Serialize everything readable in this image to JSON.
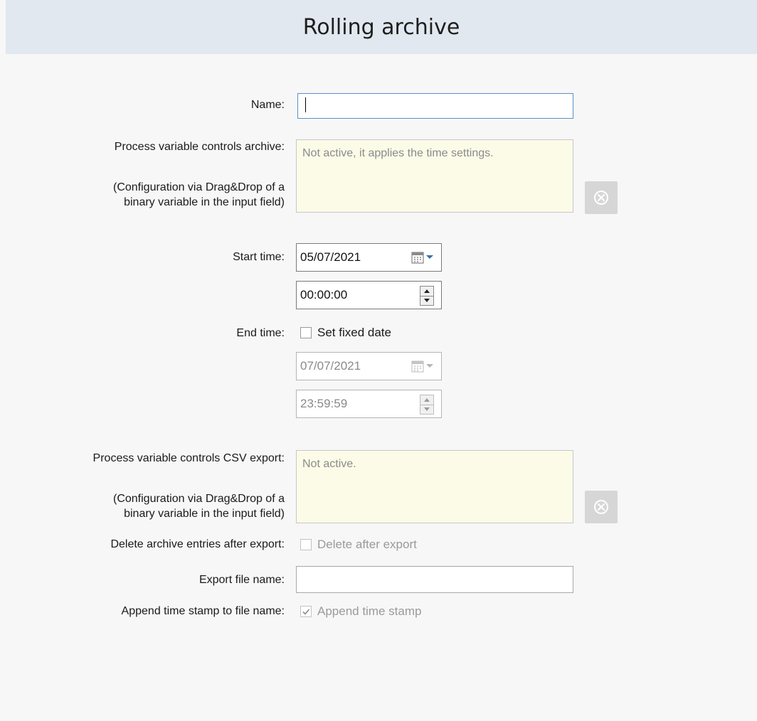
{
  "header": {
    "title": "Rolling archive"
  },
  "labels": {
    "name": "Name:",
    "pv_archive": "Process variable controls archive:",
    "pv_archive_hint_1": "(Configuration via Drag&Drop of a",
    "pv_archive_hint_2": "binary variable in the input field)",
    "start_time": "Start time:",
    "end_time": "End time:",
    "pv_csv": "Process variable controls CSV export:",
    "pv_csv_hint_1": "(Configuration via Drag&Drop of a",
    "pv_csv_hint_2": "binary variable in the input field)",
    "delete_entries": "Delete archive entries after export:",
    "export_file_name": "Export file name:",
    "append_timestamp": "Append time stamp to file name:"
  },
  "fields": {
    "name": {
      "value": ""
    },
    "pv_archive": {
      "text": "Not active, it applies the time settings."
    },
    "start_date": {
      "value": "05/07/2021"
    },
    "start_time": {
      "value": "00:00:00"
    },
    "end_fixed_date": {
      "label": "Set fixed date",
      "checked": false
    },
    "end_date": {
      "value": "07/07/2021",
      "enabled": false
    },
    "end_time": {
      "value": "23:59:59",
      "enabled": false
    },
    "pv_csv": {
      "text": "Not active."
    },
    "delete_after_export": {
      "label": "Delete after export",
      "checked": false,
      "enabled": false
    },
    "export_file_name": {
      "value": ""
    },
    "append_timestamp": {
      "label": "Append time stamp",
      "checked": true,
      "enabled": false
    }
  },
  "icons": {
    "clear": "clear-icon",
    "calendar": "calendar-icon",
    "spin": "spin-icon",
    "check": "checkmark-icon"
  },
  "colors": {
    "header_bg": "#e1e8ef",
    "area_bg": "#fbfbe8",
    "focus_border": "#5a8fc7"
  }
}
